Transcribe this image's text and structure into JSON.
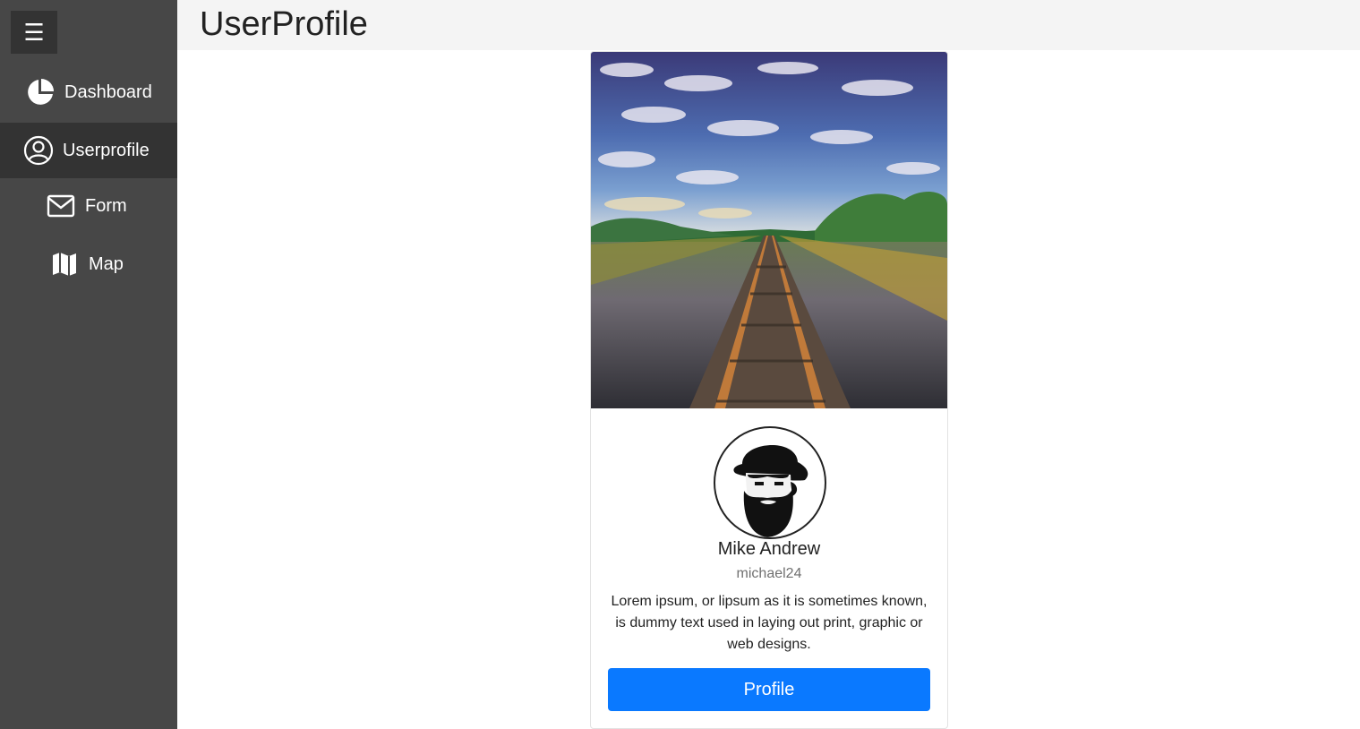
{
  "sidebar": {
    "toggle_icon": "☰",
    "items": [
      {
        "label": "Dashboard",
        "icon": "pie-chart-icon",
        "active": false
      },
      {
        "label": "Userprofile",
        "icon": "user-circle-icon",
        "active": true
      },
      {
        "label": "Form",
        "icon": "envelope-icon",
        "active": false
      },
      {
        "label": "Map",
        "icon": "map-icon",
        "active": false
      }
    ]
  },
  "header": {
    "title": "UserProfile"
  },
  "profile": {
    "cover_image": "railroad-tracks-under-cloudy-sky",
    "avatar": "bearded-man-with-hat",
    "name": "Mike Andrew",
    "username": "michael24",
    "bio": "Lorem ipsum, or lipsum as it is sometimes known, is dummy text used in laying out print, graphic or web designs.",
    "button_label": "Profile"
  },
  "colors": {
    "sidebar_bg": "#474747",
    "sidebar_active_bg": "#333333",
    "topbar_bg": "#f4f4f4",
    "primary_button": "#0a79ff"
  }
}
